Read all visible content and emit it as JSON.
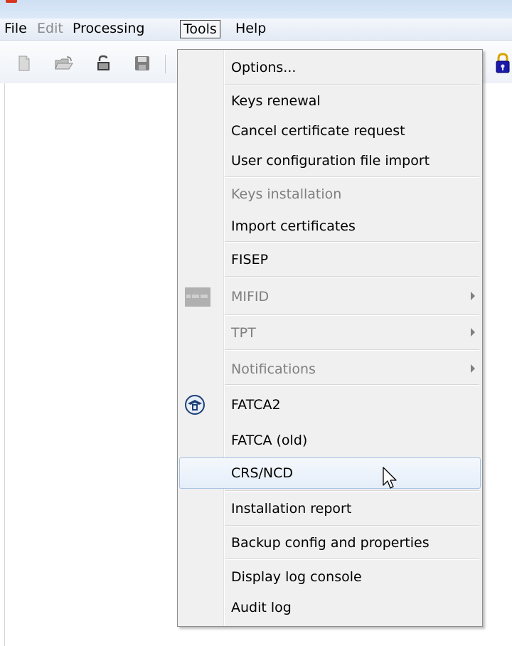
{
  "menubar": {
    "items": [
      {
        "label": "File",
        "state": "normal"
      },
      {
        "label": "Edit",
        "state": "disabled"
      },
      {
        "label": "Processing",
        "state": "normal"
      },
      {
        "label": "Tools",
        "state": "open"
      },
      {
        "label": "Help",
        "state": "normal"
      }
    ]
  },
  "toolbar": {
    "buttons": [
      "new-file-icon",
      "open-folder-icon",
      "unlock-icon",
      "save-disk-icon"
    ],
    "right_icon": "padlock-icon"
  },
  "tools_menu": {
    "items": [
      {
        "label": "Options...",
        "enabled": true
      },
      {
        "label": "Keys renewal",
        "enabled": true
      },
      {
        "label": "Cancel certificate request",
        "enabled": true
      },
      {
        "label": "User configuration file import",
        "enabled": true
      },
      {
        "label": "Keys installation",
        "enabled": false
      },
      {
        "label": "Import certificates",
        "enabled": true
      },
      {
        "label": "FISEP",
        "enabled": true
      },
      {
        "label": "MIFID",
        "enabled": false,
        "submenu": true,
        "icon": "mifid-icon"
      },
      {
        "label": "TPT",
        "enabled": false,
        "submenu": true
      },
      {
        "label": "Notifications",
        "enabled": false,
        "submenu": true
      },
      {
        "label": "FATCA2",
        "enabled": true,
        "icon": "irs-eagle-icon"
      },
      {
        "label": "FATCA (old)",
        "enabled": true
      },
      {
        "label": "CRS/NCD",
        "enabled": true,
        "highlighted": true
      },
      {
        "label": "Installation report",
        "enabled": true
      },
      {
        "label": "Backup config and properties",
        "enabled": true
      },
      {
        "label": "Display log console",
        "enabled": true
      },
      {
        "label": "Audit log",
        "enabled": true
      }
    ]
  },
  "colors": {
    "menubar_bg": "#e4ebf5",
    "menu_bg": "#f0f0f0",
    "highlight_border": "#a8c3e4",
    "disabled_text": "#7f7f7f",
    "lock_body": "#1a1aa8",
    "lock_shackle": "#d9a400"
  }
}
